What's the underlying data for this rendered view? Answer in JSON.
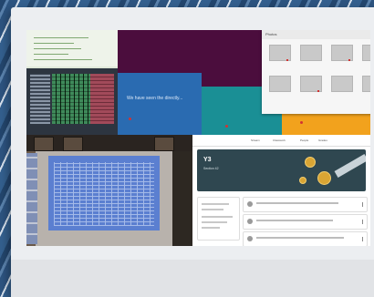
{
  "collage": {
    "slides": {
      "body_text": "We have seen the directly..."
    },
    "file_picker": {
      "window_title": "Photos"
    },
    "classroom": {
      "nav": [
        "Stream",
        "Classwork",
        "People",
        "Grades"
      ],
      "class_code": "Y3",
      "class_sub": "Section 42"
    }
  },
  "colors": {
    "slides_background": "#4b0d3d",
    "tile_blue": "#2a6bb1",
    "tile_teal": "#1a8f95",
    "tile_orange": "#f2a21d",
    "banner": "#2f4750",
    "marker_red": "#d23333"
  },
  "icons": [
    "close-icon",
    "minimize-icon",
    "maximize-icon",
    "kebab-menu-icon"
  ]
}
